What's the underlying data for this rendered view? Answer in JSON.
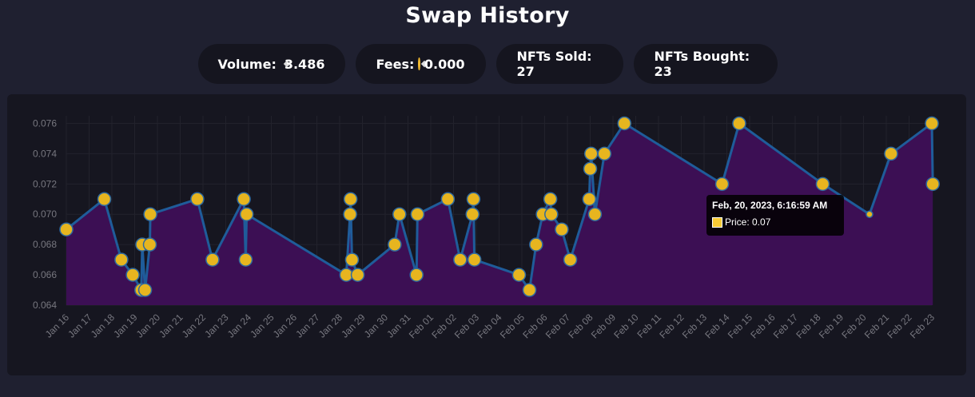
{
  "header": {
    "title": "Swap History"
  },
  "stats": {
    "volume_label": "Volume:",
    "volume_value": "3.486",
    "fees_label": "Fees:",
    "fees_value": "0.000",
    "sold": "NFTs Sold: 27",
    "bought": "NFTs Bought: 23"
  },
  "tooltip": {
    "title": "Feb, 20, 2023, 6:16:59 AM",
    "label": "Price: 0.07"
  },
  "colors": {
    "background": "#1f2030",
    "panel": "#161620",
    "line": "#1f5c9a",
    "area": "#3c0f54",
    "point": "#e7b51f",
    "coin": "#f3ba2f"
  },
  "chart_data": {
    "type": "area",
    "title": "",
    "xlabel": "",
    "ylabel": "",
    "ylim": [
      0.064,
      0.0765
    ],
    "xlim": [
      "2023-01-16",
      "2023-02-23"
    ],
    "y_ticks": [
      "0.064",
      "0.066",
      "0.068",
      "0.070",
      "0.072",
      "0.074",
      "0.076"
    ],
    "x_ticks": [
      "Jan 16",
      "Jan 17",
      "Jan 18",
      "Jan 19",
      "Jan 20",
      "Jan 21",
      "Jan 22",
      "Jan 23",
      "Jan 24",
      "Jan 25",
      "Jan 26",
      "Jan 27",
      "Jan 28",
      "Jan 29",
      "Jan 30",
      "Jan 31",
      "Feb 01",
      "Feb 02",
      "Feb 03",
      "Feb 04",
      "Feb 05",
      "Feb 06",
      "Feb 07",
      "Feb 08",
      "Feb 09",
      "Feb 10",
      "Feb 11",
      "Feb 12",
      "Feb 13",
      "Feb 14",
      "Feb 15",
      "Feb 16",
      "Feb 17",
      "Feb 18",
      "Feb 19",
      "Feb 20",
      "Feb 21",
      "Feb 22",
      "Feb 23"
    ],
    "grid": true,
    "series": [
      {
        "values": [
          [
            "Jan 16 00:00",
            0.069
          ],
          [
            "Jan 17 16:00",
            0.071
          ],
          [
            "Jan 18 10:00",
            0.067
          ],
          [
            "Jan 18 22:00",
            0.066
          ],
          [
            "Jan 19 07:00",
            0.065
          ],
          [
            "Jan 19 08:00",
            0.068
          ],
          [
            "Jan 19 11:00",
            0.065
          ],
          [
            "Jan 19 16:00",
            0.068
          ],
          [
            "Jan 19 16:30",
            0.07
          ],
          [
            "Jan 21 18:00",
            0.071
          ],
          [
            "Jan 22 10:00",
            0.067
          ],
          [
            "Jan 23 19:00",
            0.071
          ],
          [
            "Jan 23 21:00",
            0.067
          ],
          [
            "Jan 23 22:00",
            0.07
          ],
          [
            "Jan 28 07:00",
            0.066
          ],
          [
            "Jan 28 11:00",
            0.07
          ],
          [
            "Jan 28 11:30",
            0.071
          ],
          [
            "Jan 28 13:00",
            0.067
          ],
          [
            "Jan 28 19:00",
            0.066
          ],
          [
            "Jan 30 10:00",
            0.068
          ],
          [
            "Jan 30 15:00",
            0.07
          ],
          [
            "Jan 31 09:00",
            0.066
          ],
          [
            "Jan 31 10:00",
            0.07
          ],
          [
            "Feb 01 18:00",
            0.071
          ],
          [
            "Feb 02 07:00",
            0.067
          ],
          [
            "Feb 02 20:00",
            0.07
          ],
          [
            "Feb 02 21:00",
            0.071
          ],
          [
            "Feb 02 22:00",
            0.067
          ],
          [
            "Feb 04 21:00",
            0.066
          ],
          [
            "Feb 05 08:00",
            0.065
          ],
          [
            "Feb 05 15:00",
            0.068
          ],
          [
            "Feb 05 22:00",
            0.07
          ],
          [
            "Feb 06 06:00",
            0.071
          ],
          [
            "Feb 06 07:00",
            0.07
          ],
          [
            "Feb 06 18:00",
            0.069
          ],
          [
            "Feb 07 03:00",
            0.067
          ],
          [
            "Feb 07 23:00",
            0.071
          ],
          [
            "Feb 08 00:00",
            0.073
          ],
          [
            "Feb 08 01:00",
            0.074
          ],
          [
            "Feb 08 05:00",
            0.07
          ],
          [
            "Feb 08 15:00",
            0.074
          ],
          [
            "Feb 09 12:00",
            0.076
          ],
          [
            "Feb 13 19:00",
            0.072
          ],
          [
            "Feb 14 13:00",
            0.076
          ],
          [
            "Feb 18 05:00",
            0.072
          ],
          [
            "Feb 20 06:17",
            0.07
          ],
          [
            "Feb 21 05:00",
            0.074
          ],
          [
            "Feb 23 00:00",
            0.076
          ],
          [
            "Feb 23 01:00",
            0.072
          ]
        ]
      }
    ]
  }
}
